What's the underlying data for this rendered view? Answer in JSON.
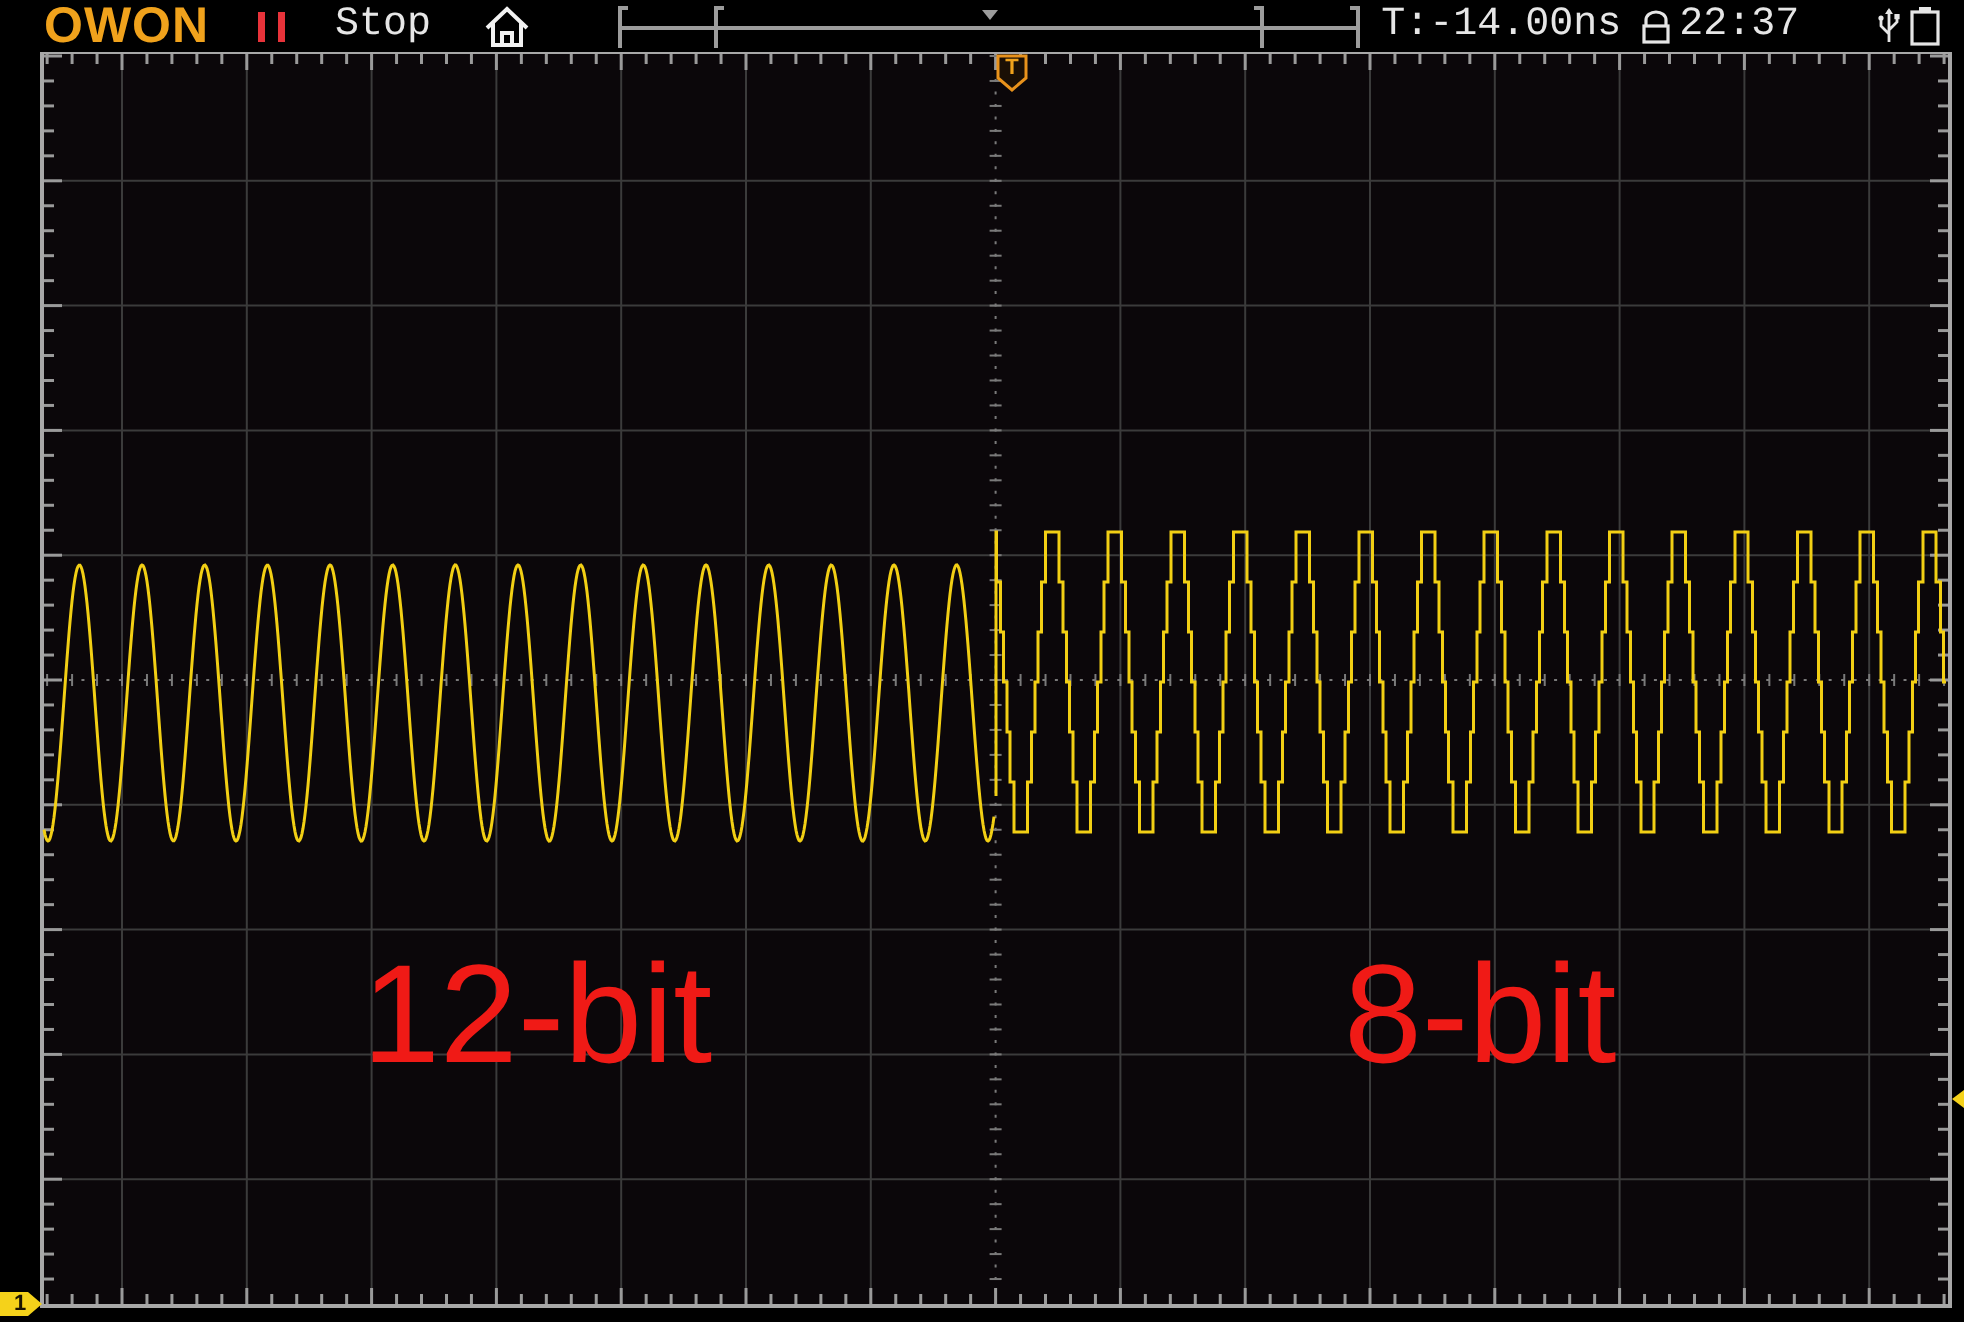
{
  "header": {
    "logo": "OWON",
    "run_status": "Stop",
    "trigger_time": "T:-14.00ns",
    "clock": "22:37"
  },
  "display": {
    "trigger_marker": "T",
    "channel_marker": "1",
    "annotations": [
      "12-bit",
      "8-bit"
    ]
  }
}
